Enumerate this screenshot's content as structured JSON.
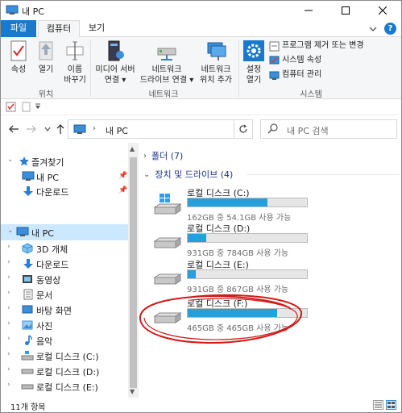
{
  "window": {
    "title": "내 PC"
  },
  "tabs": {
    "file": "파일",
    "computer": "컴퓨터",
    "view": "보기"
  },
  "ribbon": {
    "location": {
      "properties": "속성",
      "open": "열기",
      "rename_line1": "이름",
      "rename_line2": "바꾸기",
      "group": "위치"
    },
    "network": {
      "media_line1": "미디어 서버",
      "media_line2": "연결",
      "map_line1": "네트워크",
      "map_line2": "드라이브 연결",
      "add_line1": "네트워크",
      "add_line2": "위치 추가",
      "group": "네트워크"
    },
    "system": {
      "settings_line1": "설정",
      "settings_line2": "열기",
      "uninstall": "프로그램 제거 또는 변경",
      "sys_props": "시스템 속성",
      "manage": "컴퓨터 관리",
      "group": "시스템"
    }
  },
  "address": {
    "path": "내 PC",
    "separator": "›"
  },
  "search": {
    "placeholder": "내 PC 검색"
  },
  "nav": {
    "quick_access": "즐겨찾기",
    "items_pinned": [
      {
        "label": "내 PC"
      },
      {
        "label": "다운로드"
      }
    ],
    "this_pc": "내 PC",
    "pc_items": [
      {
        "label": "3D 개체"
      },
      {
        "label": "다운로드"
      },
      {
        "label": "동영상"
      },
      {
        "label": "문서"
      },
      {
        "label": "바탕 화면"
      },
      {
        "label": "사진"
      },
      {
        "label": "음악"
      },
      {
        "label": "로컬 디스크 (C:)"
      },
      {
        "label": "로컬 디스크 (D:)"
      },
      {
        "label": "로컬 디스크 (E:)"
      }
    ]
  },
  "content": {
    "folders_header": "폴더 (7)",
    "drives_header": "장치 및 드라이브 (4)",
    "drives": [
      {
        "name": "로컬 디스크 (C:)",
        "space": "162GB 중 54.1GB 사용 가능",
        "used_fraction": 0.666
      },
      {
        "name": "로컬 디스크 (D:)",
        "space": "931GB 중 784GB 사용 가능",
        "used_fraction": 0.158
      },
      {
        "name": "로컬 디스크 (E:)",
        "space": "931GB 중 867GB 사용 가능",
        "used_fraction": 0.069
      },
      {
        "name": "로컬 디스크 (F:)",
        "space": "465GB 중 465GB 사용 가능",
        "used_fraction": 0.75
      }
    ]
  },
  "status": {
    "count": "11개 항목"
  },
  "colors": {
    "accent": "#1979ca",
    "bar_fill": "#26a0da",
    "selection": "#cce8ff",
    "annotation": "#d11a1a"
  }
}
